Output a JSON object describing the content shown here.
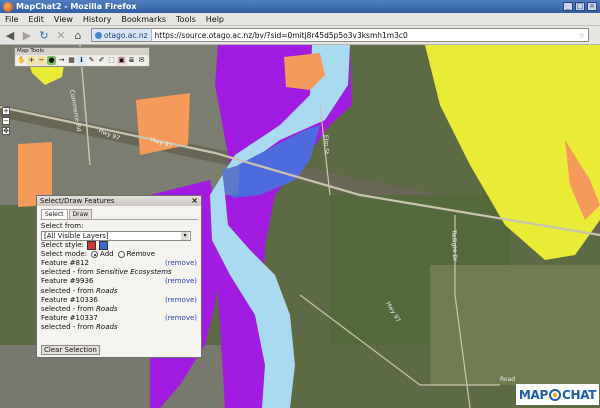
{
  "window": {
    "title": "MapChat2 - Mozilla Firefox",
    "buttons": [
      "_",
      "□",
      "×"
    ]
  },
  "menu": [
    {
      "label": "File"
    },
    {
      "label": "Edit"
    },
    {
      "label": "View"
    },
    {
      "label": "History"
    },
    {
      "label": "Bookmarks"
    },
    {
      "label": "Tools"
    },
    {
      "label": "Help"
    }
  ],
  "nav": {
    "site_id": "otago.ac.nz",
    "url": "https://source.otago.ac.nz/bv/?sid=0mitj8r45d5p5o3v3ksmh1m3c0"
  },
  "map_tools": {
    "title": "Map Tools"
  },
  "map": {
    "labels": {
      "road1": "Hwy 97",
      "road2": "Hwy 97",
      "road3": "Hwy 97",
      "road4": "Road",
      "street1": "Commerce Rd",
      "street2": "Elm St",
      "street3": "Twilight Dr"
    },
    "colors": {
      "river": "#a9dbf0",
      "sensitive": "#a21be0",
      "yellow": "#e9eb36",
      "orange": "#f59a5a",
      "selected": "#4e6bde"
    }
  },
  "dialog": {
    "title": "Select/Draw Features",
    "tabs": [
      "Select",
      "Draw"
    ],
    "select_from_label": "Select from:",
    "select_from_value": "[All Visible Layers]",
    "style_label": "Select style:",
    "mode_label": "Select mode:",
    "mode_add": "Add",
    "mode_remove": "Remove",
    "features": [
      {
        "title": "Feature #812",
        "remove": "(remove)",
        "selected_prefix": "selected - from ",
        "source": "Sensitive Ecosystems"
      },
      {
        "title": "Feature #9936",
        "remove": "(remove)",
        "selected_prefix": "selected - from ",
        "source": "Roads"
      },
      {
        "title": "Feature #10336",
        "remove": "(remove)",
        "selected_prefix": "selected - from ",
        "source": "Roads"
      },
      {
        "title": "Feature #10337",
        "remove": "(remove)",
        "selected_prefix": "selected - from ",
        "source": "Roads"
      }
    ],
    "clear_button": "Clear Selection"
  },
  "logo": {
    "left": "MAP",
    "right": "CHAT"
  }
}
